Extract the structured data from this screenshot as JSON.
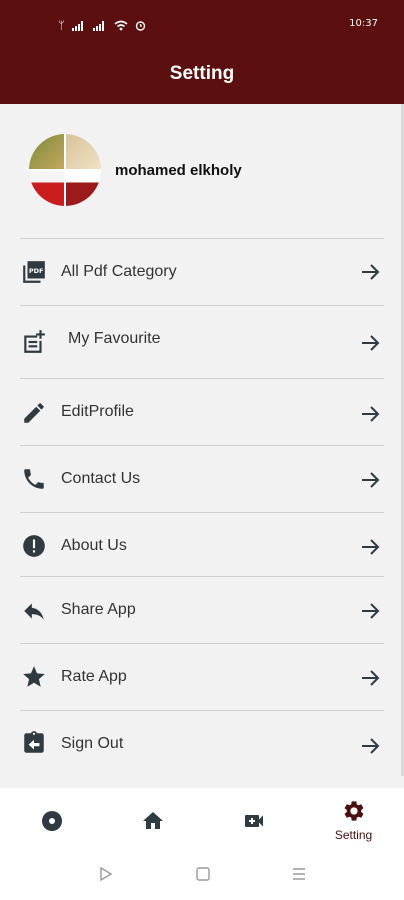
{
  "status_bar": {
    "time": "10:37",
    "icons": [
      "usb-icon",
      "signal-icon",
      "signal-icon",
      "wifi-icon",
      "alarm-icon"
    ]
  },
  "app_bar": {
    "title": "Setting"
  },
  "profile": {
    "name": "mohamed elkholy"
  },
  "menu": {
    "items": [
      {
        "label": "All Pdf Category",
        "icon": "pdf-icon"
      },
      {
        "label": "My Favourite",
        "icon": "note-add-icon"
      },
      {
        "label": "EditProfile",
        "icon": "pencil-icon"
      },
      {
        "label": "Contact Us",
        "icon": "phone-icon"
      },
      {
        "label": "About Us",
        "icon": "info-alert-icon"
      },
      {
        "label": "Share App",
        "icon": "reply-icon"
      },
      {
        "label": "Rate App",
        "icon": "star-icon"
      },
      {
        "label": "Sign Out",
        "icon": "clipboard-back-icon"
      }
    ]
  },
  "bottom_nav": {
    "tabs": [
      {
        "name": "disc",
        "label": ""
      },
      {
        "name": "home",
        "label": ""
      },
      {
        "name": "video",
        "label": ""
      },
      {
        "name": "setting",
        "label": "Setting"
      }
    ],
    "active_tab": "setting",
    "active_color": "#4a1010"
  },
  "colors": {
    "primary": "#5b0f0f",
    "icon": "#2f3b40",
    "background": "#f2f2f2"
  }
}
